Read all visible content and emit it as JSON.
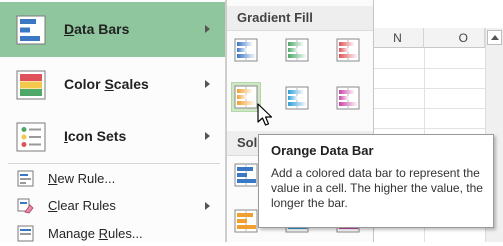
{
  "menu": {
    "data_bars": {
      "prefix": "",
      "mnemonic": "D",
      "rest": "ata Bars"
    },
    "color_scales": {
      "prefix": "Color ",
      "mnemonic": "S",
      "rest": "cales"
    },
    "icon_sets": {
      "prefix": "",
      "mnemonic": "I",
      "rest": "con Sets"
    },
    "new_rule": {
      "prefix": "",
      "mnemonic": "N",
      "rest": "ew Rule..."
    },
    "clear_rules": {
      "prefix": "",
      "mnemonic": "C",
      "rest": "lear Rules"
    },
    "manage_rules": {
      "prefix": "Manage ",
      "mnemonic": "R",
      "rest": "ules..."
    }
  },
  "submenu": {
    "gradient_header": "Gradient Fill",
    "solid_header": "Sol"
  },
  "sheet": {
    "columns": [
      "N",
      "O"
    ]
  },
  "tooltip": {
    "title": "Orange Data Bar",
    "body": "Add a colored data bar to represent the value in a cell. The higher the value, the longer the bar."
  },
  "colors": {
    "highlight": "#8fc69d",
    "blue": "#3a78c3",
    "green": "#4ea868",
    "red": "#e0525a",
    "orange": "#f0a030",
    "light_blue": "#2fa0d8",
    "purple": "#c844a8"
  }
}
